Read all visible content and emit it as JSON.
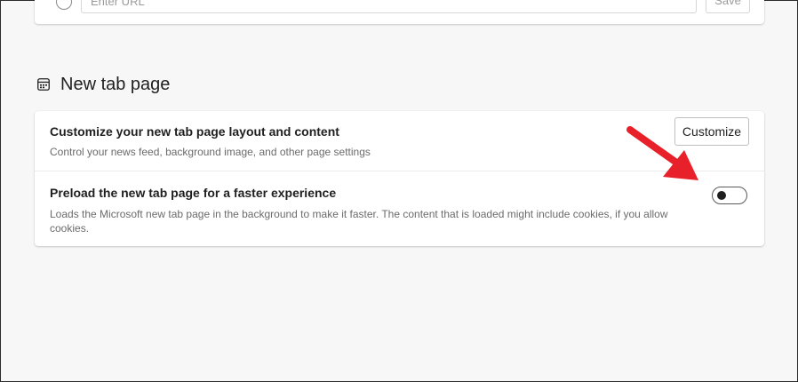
{
  "top_card": {
    "url_placeholder": "Enter URL",
    "save_label": "Save"
  },
  "section": {
    "title": "New tab page",
    "icon": "new-tab-page-icon"
  },
  "settings": [
    {
      "title": "Customize your new tab page layout and content",
      "description": "Control your news feed, background image, and other page settings",
      "button_label": "Customize"
    },
    {
      "title": "Preload the new tab page for a faster experience",
      "description": "Loads the Microsoft new tab page in the background to make it faster. The content that is loaded might include cookies, if you allow cookies.",
      "toggle_on": false
    }
  ],
  "annotation": {
    "arrow_color": "#e8202a"
  }
}
